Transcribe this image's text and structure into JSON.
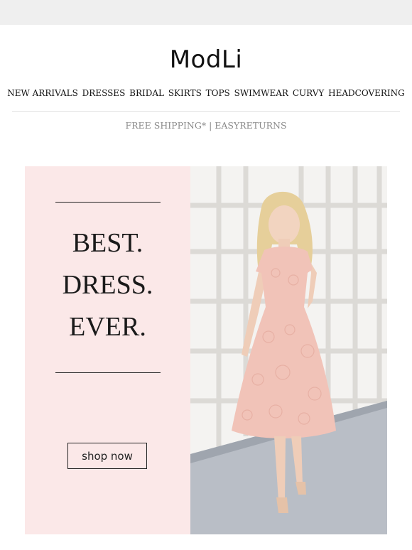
{
  "brand": {
    "logo": "ModLi"
  },
  "nav": {
    "items": [
      "NEW ARRIVALS",
      "DRESSES",
      "BRIDAL",
      "SKIRTS",
      "TOPS",
      "SWIMWEAR",
      "CURVY",
      "HEADCOVERING"
    ]
  },
  "promo": {
    "text": "FREE SHIPPING* | EASYRETURNS"
  },
  "hero": {
    "lines": [
      "BEST.",
      "DRESS.",
      "EVER."
    ],
    "cta": "shop now",
    "panel_color": "#fbe8e8",
    "dress_color": "#f1c3b8"
  }
}
